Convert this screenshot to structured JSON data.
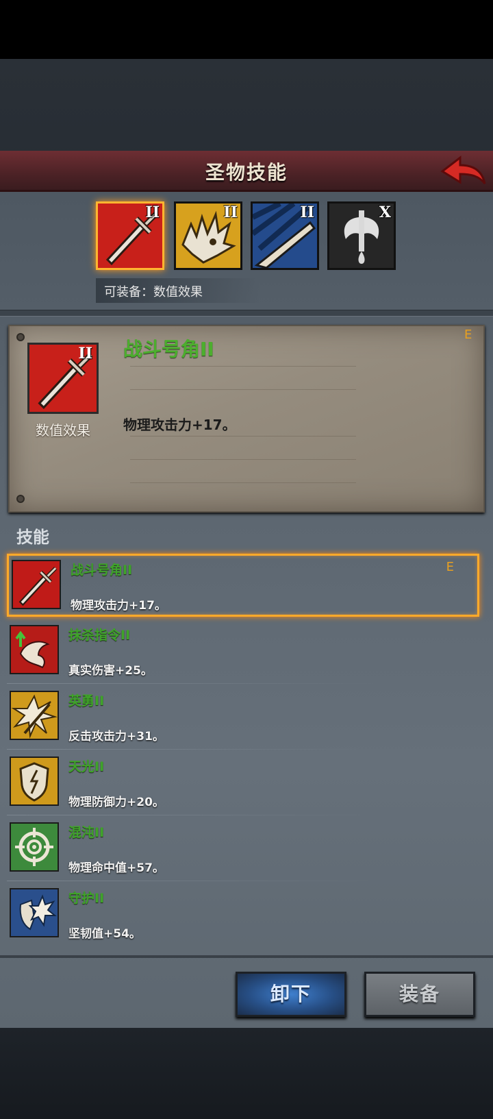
{
  "header": {
    "title": "圣物技能"
  },
  "relic_slots": [
    {
      "name": "sword",
      "tier": "II",
      "bg": "#c8201a",
      "selected": true
    },
    {
      "name": "beast",
      "tier": "II",
      "bg": "#d7a11e",
      "selected": false
    },
    {
      "name": "claw",
      "tier": "II",
      "bg": "#244b8c",
      "selected": false
    },
    {
      "name": "axe",
      "tier": "X",
      "bg": "#2a2a2a",
      "selected": false
    }
  ],
  "equip_hint": "可装备：数值效果",
  "detail": {
    "tier": "II",
    "icon_label": "数值效果",
    "name": "战斗号角II",
    "effect": "物理攻击力+17。",
    "tag": "E"
  },
  "skills_title": "技能",
  "skills": [
    {
      "name": "战斗号角II",
      "effect": "物理攻击力+17。",
      "tag": "E",
      "icon": "sword-icon",
      "bg": "#c01b18"
    },
    {
      "name": "抹杀指令II",
      "effect": "真实伤害+25。",
      "tag": "",
      "icon": "strike-icon",
      "bg": "#b61c18"
    },
    {
      "name": "英勇II",
      "effect": "反击攻击力+31。",
      "tag": "",
      "icon": "burst-icon",
      "bg": "#cf9a1c"
    },
    {
      "name": "天光II",
      "effect": "物理防御力+20。",
      "tag": "",
      "icon": "shield-icon",
      "bg": "#cf9a1c"
    },
    {
      "name": "混沌II",
      "effect": "物理命中值+57。",
      "tag": "",
      "icon": "target-icon",
      "bg": "#3d8a3c"
    },
    {
      "name": "守护II",
      "effect": "坚韧值+54。",
      "tag": "",
      "icon": "guard-icon",
      "bg": "#2a4f8c"
    }
  ],
  "buttons": {
    "unequip": "卸下",
    "equip": "装备"
  }
}
